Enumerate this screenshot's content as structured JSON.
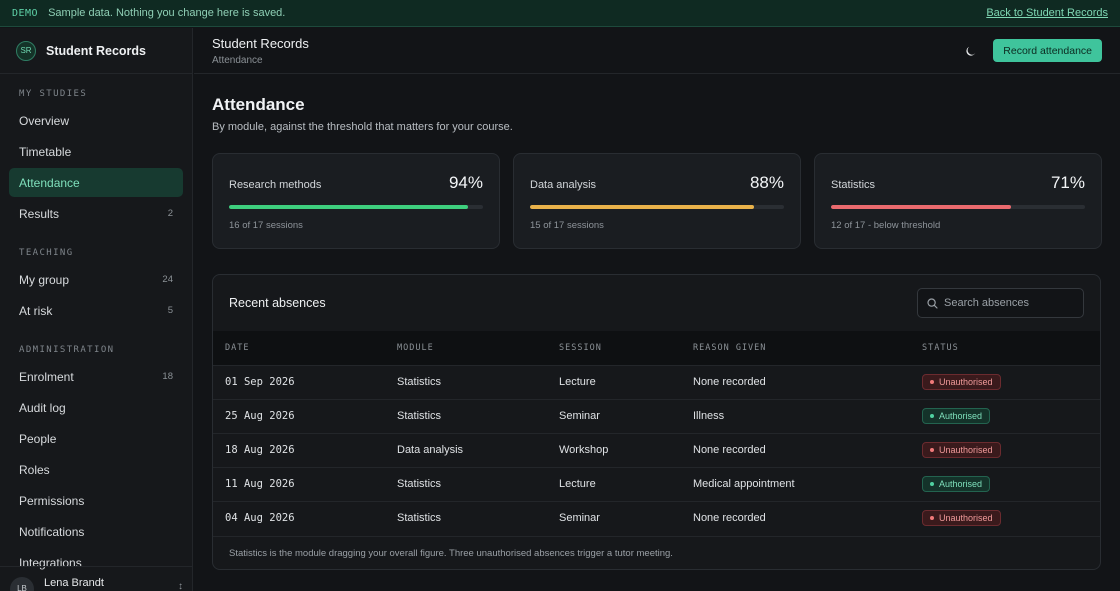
{
  "banner": {
    "tag": "DEMO",
    "message": "Sample data. Nothing you change here is saved.",
    "back_link": "Back to Student Records"
  },
  "brand": {
    "initials": "SR",
    "name": "Student Records"
  },
  "sidebar": {
    "sections": [
      {
        "label": "MY STUDIES",
        "items": [
          {
            "label": "Overview",
            "count": ""
          },
          {
            "label": "Timetable",
            "count": ""
          },
          {
            "label": "Attendance",
            "count": "",
            "active": true
          },
          {
            "label": "Results",
            "count": "2"
          }
        ]
      },
      {
        "label": "TEACHING",
        "items": [
          {
            "label": "My group",
            "count": "24"
          },
          {
            "label": "At risk",
            "count": "5"
          }
        ]
      },
      {
        "label": "ADMINISTRATION",
        "items": [
          {
            "label": "Enrolment",
            "count": "18"
          },
          {
            "label": "Audit log",
            "count": ""
          },
          {
            "label": "People",
            "count": ""
          },
          {
            "label": "Roles",
            "count": ""
          },
          {
            "label": "Permissions",
            "count": ""
          },
          {
            "label": "Notifications",
            "count": ""
          },
          {
            "label": "Integrations",
            "count": ""
          }
        ]
      }
    ],
    "user": {
      "initials": "LB",
      "name": "Lena Brandt"
    }
  },
  "topbar": {
    "title": "Student Records",
    "subtitle": "Attendance",
    "record_button": "Record attendance",
    "theme_icon": "moon-icon"
  },
  "page": {
    "title": "Attendance",
    "subtitle": "By module, against the threshold that matters for your course."
  },
  "cards": [
    {
      "module": "Research methods",
      "percent": "94%",
      "value": 0.94,
      "note": "16 of 17 sessions",
      "color": "#3ecf7e"
    },
    {
      "module": "Data analysis",
      "percent": "88%",
      "value": 0.88,
      "note": "15 of 17 sessions",
      "color": "#e9b24a"
    },
    {
      "module": "Statistics",
      "percent": "71%",
      "value": 0.71,
      "note": "12 of 17 - below threshold",
      "color": "#ea6a6e"
    }
  ],
  "absences": {
    "title": "Recent absences",
    "search_placeholder": "Search absences",
    "columns": [
      "DATE",
      "MODULE",
      "SESSION",
      "REASON GIVEN",
      "STATUS"
    ],
    "rows": [
      {
        "date": "01 Sep 2026",
        "module": "Statistics",
        "session": "Lecture",
        "reason": "None recorded",
        "status": "Unauthorised"
      },
      {
        "date": "25 Aug 2026",
        "module": "Statistics",
        "session": "Seminar",
        "reason": "Illness",
        "status": "Authorised"
      },
      {
        "date": "18 Aug 2026",
        "module": "Data analysis",
        "session": "Workshop",
        "reason": "None recorded",
        "status": "Unauthorised"
      },
      {
        "date": "11 Aug 2026",
        "module": "Statistics",
        "session": "Lecture",
        "reason": "Medical appointment",
        "status": "Authorised"
      },
      {
        "date": "04 Aug 2026",
        "module": "Statistics",
        "session": "Seminar",
        "reason": "None recorded",
        "status": "Unauthorised"
      }
    ],
    "footnote": "Statistics is the module dragging your overall figure. Three unauthorised absences trigger a tutor meeting."
  }
}
